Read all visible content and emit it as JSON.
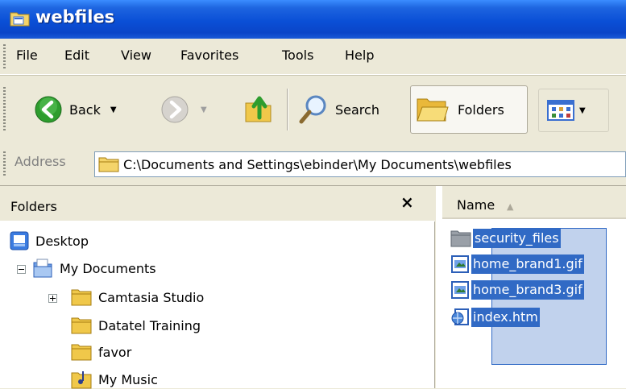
{
  "window": {
    "title": "webfiles"
  },
  "menu": {
    "items": [
      "File",
      "Edit",
      "View",
      "Favorites",
      "Tools",
      "Help"
    ]
  },
  "toolbar": {
    "back_label": "Back",
    "search_label": "Search",
    "folders_label": "Folders"
  },
  "address": {
    "label": "Address",
    "value": "C:\\Documents and Settings\\ebinder\\My Documents\\webfiles"
  },
  "folders_pane": {
    "title": "Folders",
    "close": "×",
    "tree": [
      {
        "label": "Desktop",
        "icon": "desktop-icon"
      },
      {
        "label": "My Documents",
        "icon": "my-documents-icon",
        "expander": "minus"
      },
      {
        "label": "Camtasia Studio",
        "icon": "folder-icon",
        "expander": "plus"
      },
      {
        "label": "Datatel Training",
        "icon": "folder-icon"
      },
      {
        "label": "favor",
        "icon": "folder-icon"
      },
      {
        "label": "My Music",
        "icon": "music-folder-icon"
      }
    ]
  },
  "file_list": {
    "column_name": "Name",
    "sort_arrow": "▲",
    "files": [
      {
        "name": "security_files",
        "icon": "folder-icon",
        "selected": true
      },
      {
        "name": "home_brand1.gif",
        "icon": "gif-image-icon",
        "selected": true
      },
      {
        "name": "home_brand3.gif",
        "icon": "gif-image-icon",
        "selected": true
      },
      {
        "name": "index.htm",
        "icon": "html-file-icon",
        "selected": true
      }
    ]
  },
  "colors": {
    "titlebar": "#0A4FD6",
    "selection": "#316AC5",
    "chrome": "#ECE9D8"
  }
}
